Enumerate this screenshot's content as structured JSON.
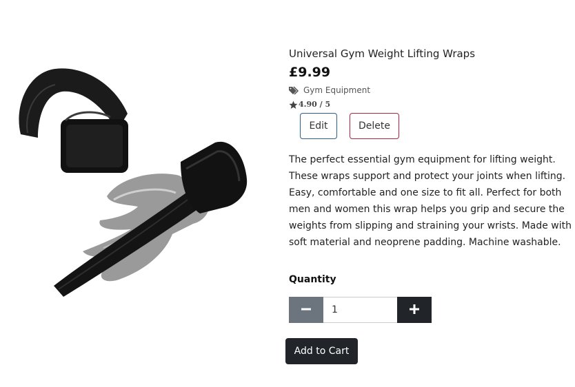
{
  "product": {
    "name": "Universal Gym Weight Lifting Wraps",
    "price": "£9.99",
    "category": "Gym Equipment",
    "rating": "4.90 / 5",
    "description": "The perfect essential gym equipment for lifting weight. These wraps support and protect your joints when lifting. Easy, comfortable and one size to fit all. Perfect for both men and women this wrap helps you grip and secure the weights from slipping and straining your wrists. Made with soft material and neoprene padding. Machine washable."
  },
  "admin": {
    "edit_label": "Edit",
    "delete_label": "Delete"
  },
  "quantity": {
    "label": "Quantity",
    "value": "1"
  },
  "cart": {
    "add_label": "Add to Cart"
  },
  "icons": {
    "category": "tags-icon",
    "rating": "star-icon",
    "decrement": "minus-icon",
    "increment": "plus-icon"
  },
  "colors": {
    "edit_border": "#2a5f8f",
    "delete_border": "#b0233a",
    "dark_button": "#212529",
    "secondary_button": "#6c757d"
  }
}
